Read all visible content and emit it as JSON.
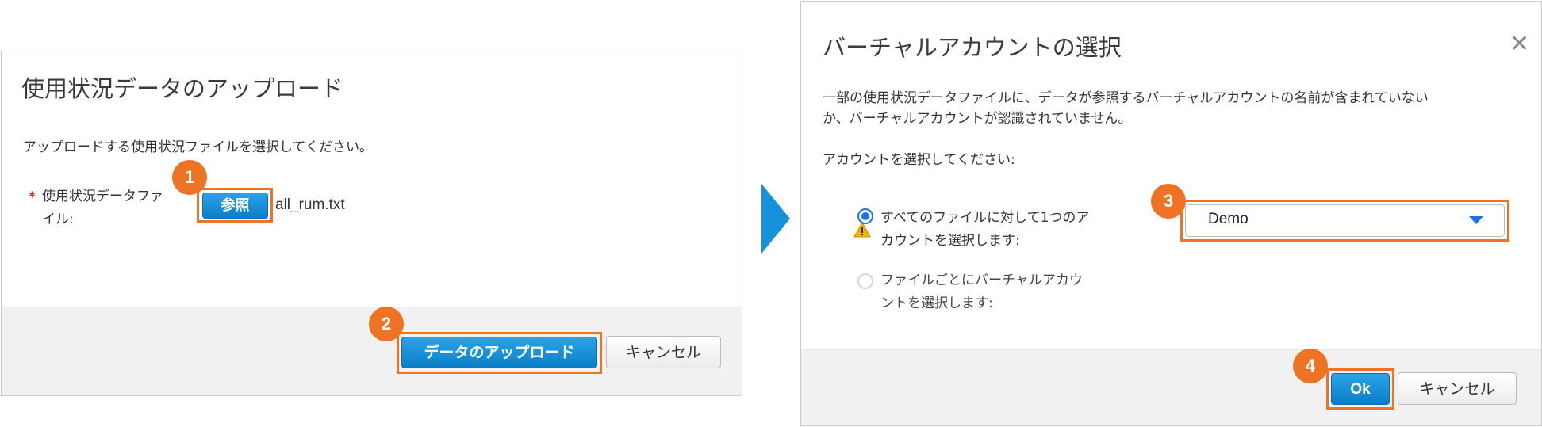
{
  "upload_dialog": {
    "title": "使用状況データのアップロード",
    "instruction": "アップロードする使用状況ファイルを選択してください。",
    "required_mark": "*",
    "file_label_line1": "使用状況データファ",
    "file_label_line2": "イル:",
    "browse_label": "参照",
    "file_name": "all_rum.txt",
    "upload_label": "データのアップロード",
    "cancel_label": "キャンセル"
  },
  "virtual_account_dialog": {
    "title": "バーチャルアカウントの選択",
    "close_glyph": "✕",
    "message_line1": "一部の使用状況データファイルに、データが参照するバーチャルアカウントの名前が含まれていない",
    "message_line2": "か、バーチャルアカウントが認識されていません。",
    "prompt": "アカウントを選択してください:",
    "option_all_line1": "すべてのファイルに対して1つのア",
    "option_all_line2": "カウントを選択します:",
    "option_each_line1": "ファイルごとにバーチャルアカウ",
    "option_each_line2": "ントを選択します:",
    "selected_account": "Demo",
    "ok_label": "Ok",
    "cancel_label": "キャンセル"
  },
  "badges": [
    "1",
    "2",
    "3",
    "4"
  ],
  "colors": {
    "highlight": "#ee7424",
    "primary": "#0a7fc9",
    "arrow": "#1592da",
    "warning": "#f0b400",
    "radio": "#1a73e8"
  },
  "icons": [
    "warning-icon",
    "chevron-down-icon",
    "close-icon",
    "next-arrow-icon"
  ]
}
